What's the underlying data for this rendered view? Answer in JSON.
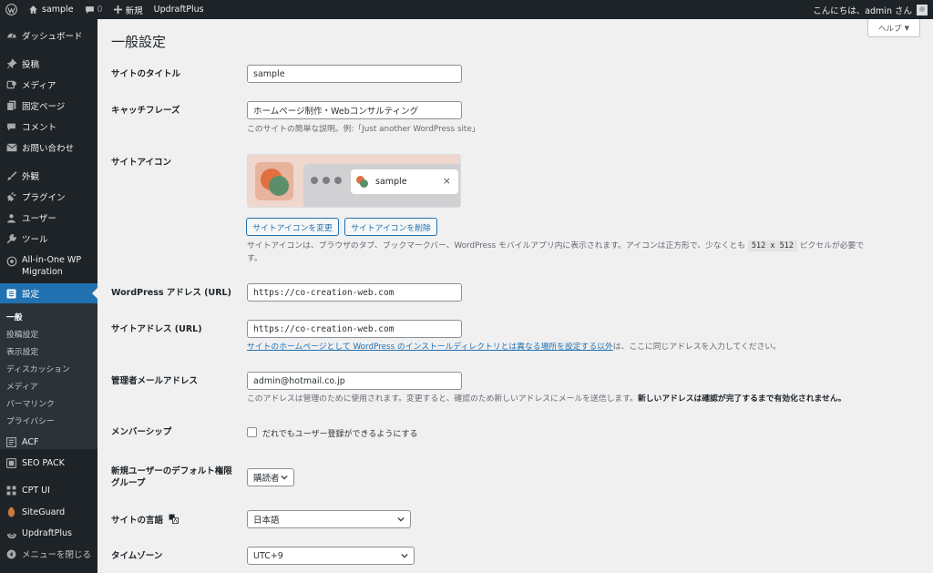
{
  "adminbar": {
    "site_name": "sample",
    "comments_count": "0",
    "new_label": "新規",
    "plugin_label": "UpdraftPlus",
    "greeting": "こんにちは、admin さん"
  },
  "sidebar": {
    "items": [
      {
        "label": "ダッシュボード",
        "icon": "dashboard-icon"
      },
      {
        "label": "投稿",
        "icon": "pin-icon"
      },
      {
        "label": "メディア",
        "icon": "media-icon"
      },
      {
        "label": "固定ページ",
        "icon": "page-icon"
      },
      {
        "label": "コメント",
        "icon": "comment-icon"
      },
      {
        "label": "お問い合わせ",
        "icon": "mail-icon"
      },
      {
        "label": "外観",
        "icon": "brush-icon"
      },
      {
        "label": "プラグイン",
        "icon": "plugin-icon"
      },
      {
        "label": "ユーザー",
        "icon": "user-icon"
      },
      {
        "label": "ツール",
        "icon": "wrench-icon"
      },
      {
        "label": "All-in-One WP Migration",
        "icon": "migration-icon"
      },
      {
        "label": "設定",
        "icon": "settings-icon"
      },
      {
        "label": "ACF",
        "icon": "acf-icon"
      },
      {
        "label": "SEO PACK",
        "icon": "seo-pack-icon"
      },
      {
        "label": "CPT UI",
        "icon": "cpt-ui-icon"
      },
      {
        "label": "SiteGuard",
        "icon": "siteguard-icon"
      },
      {
        "label": "UpdraftPlus",
        "icon": "updraftplus-icon"
      },
      {
        "label": "メニューを閉じる",
        "icon": "collapse-icon"
      }
    ],
    "submenu": [
      "一般",
      "投稿設定",
      "表示設定",
      "ディスカッション",
      "メディア",
      "パーマリンク",
      "プライバシー"
    ]
  },
  "main": {
    "title": "一般設定",
    "help_label": "ヘルプ",
    "site_title_label": "サイトのタイトル",
    "site_title_value": "sample",
    "tagline_label": "キャッチフレーズ",
    "tagline_value": "ホームページ制作・Webコンサルティング",
    "tagline_desc": "このサイトの簡単な説明。例:「Just another WordPress site」",
    "site_icon_label": "サイトアイコン",
    "preview_site_name": "sample",
    "change_icon_button": "サイトアイコンを変更",
    "remove_icon_button": "サイトアイコンを削除",
    "site_icon_desc_1": "サイトアイコンは、ブラウザのタブ、ブックマークバー、WordPress モバイルアプリ内に表示されます。アイコンは正方形で、少なくとも",
    "site_icon_size": "512 x 512",
    "site_icon_desc_2": "ピクセルが必要で",
    "site_icon_desc_3": "す。",
    "wp_address_label": "WordPress アドレス (URL)",
    "wp_address_value": "https://co-creation-web.com",
    "site_address_label": "サイトアドレス (URL)",
    "site_address_value": "https://co-creation-web.com",
    "site_address_link": "サイトのホームページとして WordPress のインストールディレクトリとは異なる場所を設定する以外",
    "site_address_desc": "は、ここに同じアドレスを入力してください。",
    "admin_email_label": "管理者メールアドレス",
    "admin_email_value": "admin@hotmail.co.jp",
    "admin_email_desc": "このアドレスは管理のために使用されます。変更すると、確認のため新しいアドレスにメールを送信します。",
    "admin_email_desc_bold": "新しいアドレスは確認が完了するまで有効化されません。",
    "membership_label": "メンバーシップ",
    "membership_checkbox_label": "だれでもユーザー登録ができるようにする",
    "default_role_label": "新規ユーザーのデフォルト権限グループ",
    "default_role_value": "購読者",
    "language_label": "サイトの言語",
    "language_value": "日本語",
    "timezone_label": "タイムゾーン",
    "timezone_value": "UTC+9"
  },
  "colors": {
    "adminbar_bg": "#1d2327",
    "sidebar_bg": "#1d2327",
    "current_menu_bg": "#2271b1",
    "link": "#2271b1",
    "content_bg": "#f0f0f1"
  }
}
